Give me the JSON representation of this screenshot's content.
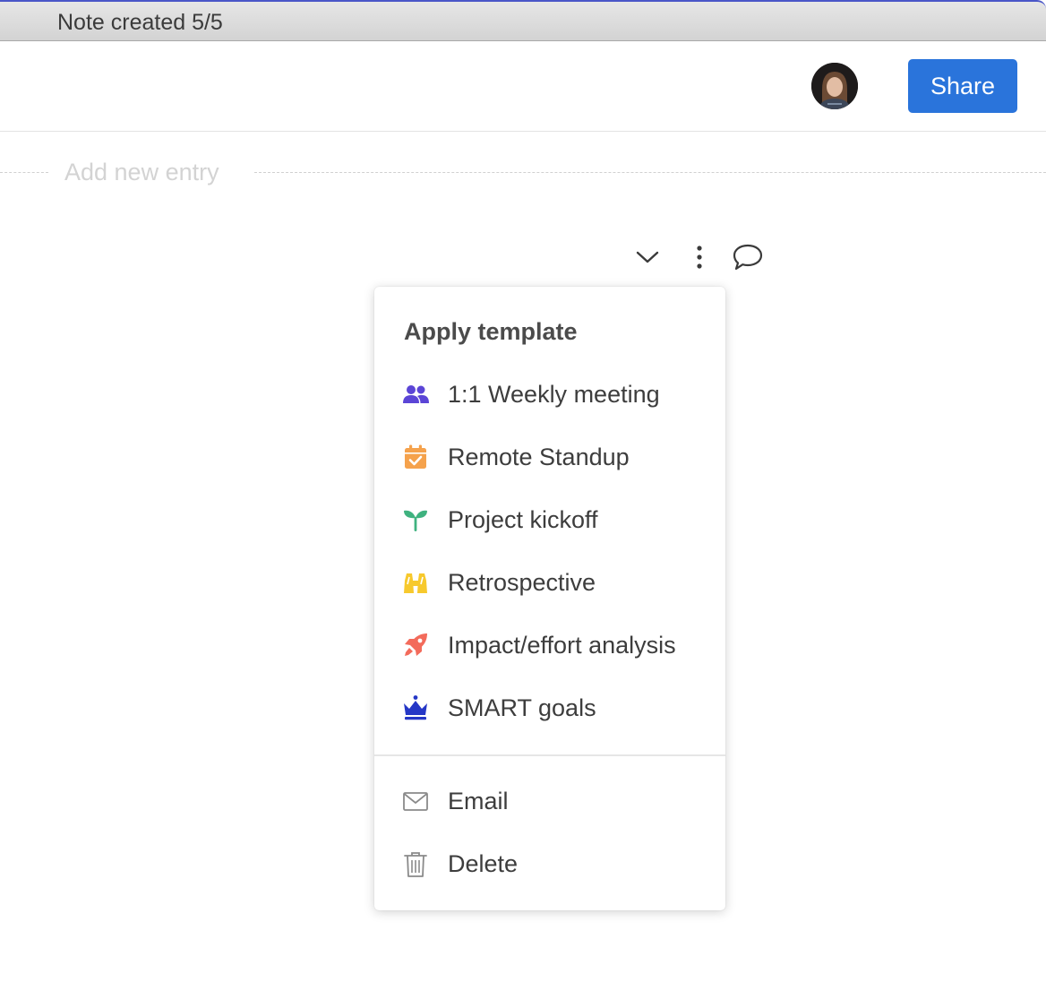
{
  "window": {
    "title": "Note created 5/5"
  },
  "header": {
    "share_label": "Share",
    "avatar_icon": "user-avatar"
  },
  "editor": {
    "add_entry_placeholder": "Add new entry"
  },
  "toolbar": {
    "icons": [
      "chevron-down-icon",
      "more-vertical-icon",
      "comment-icon"
    ]
  },
  "menu": {
    "heading": "Apply template",
    "templates": [
      {
        "label": "1:1 Weekly meeting",
        "icon": "people-icon",
        "color": "#5b45d6"
      },
      {
        "label": "Remote Standup",
        "icon": "calendar-check-icon",
        "color": "#f5a24c"
      },
      {
        "label": "Project kickoff",
        "icon": "sprout-icon",
        "color": "#3fb27f"
      },
      {
        "label": "Retrospective",
        "icon": "binoculars-icon",
        "color": "#f7c92d"
      },
      {
        "label": "Impact/effort analysis",
        "icon": "rocket-icon",
        "color": "#f36b5b"
      },
      {
        "label": "SMART goals",
        "icon": "crown-icon",
        "color": "#2537c6"
      }
    ],
    "actions": [
      {
        "label": "Email",
        "icon": "envelope-icon"
      },
      {
        "label": "Delete",
        "icon": "trash-icon"
      }
    ]
  },
  "colors": {
    "accent": "#2a74db",
    "titlebar_border": "#4a56c8"
  }
}
